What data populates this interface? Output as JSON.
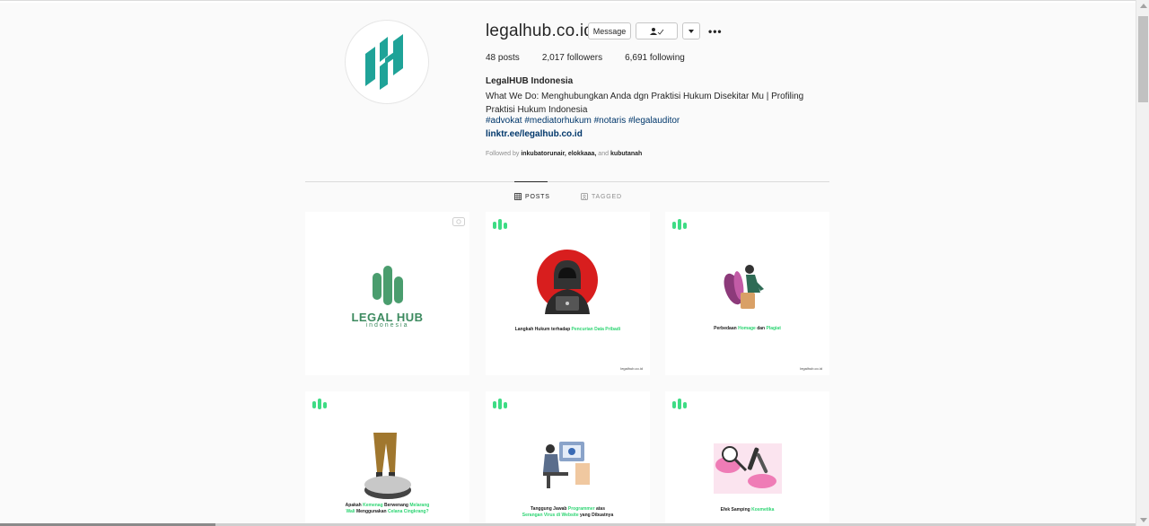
{
  "profile": {
    "username": "legalhub.co.id",
    "message_label": "Message",
    "stats": {
      "posts_count": "48",
      "posts_label": "posts",
      "followers_count": "2,017",
      "followers_label": "followers",
      "following_count": "6,691",
      "following_label": "following"
    },
    "full_name": "LegalHUB Indonesia",
    "bio": "What We Do: Menghubungkan Anda dgn Praktisi Hukum Disekitar Mu | Profiling Praktisi Hukum Indonesia",
    "hashtags": "#advokat #mediatorhukum #notaris #legalauditor",
    "link": "linktr.ee/legalhub.co.id",
    "followed_by_prefix": "Followed by",
    "followed_by_names": "inkubatorunair, elokkaaa,",
    "followed_by_and": "and",
    "followed_by_last": "kubutanah"
  },
  "tabs": [
    {
      "label": "POSTS",
      "active": true
    },
    {
      "label": "TAGGED",
      "active": false
    }
  ],
  "posts": [
    {
      "logo_text": "LEGAL HUB",
      "logo_sub": "indonesia"
    },
    {
      "caption_a": "Langkah Hukum terhadap",
      "caption_b": "Pencurian Data Pribadi",
      "footer": "legalhub.co.id"
    },
    {
      "caption_a": "Perbedaan",
      "caption_b": "Homage",
      "caption_c": "dan",
      "caption_d": "Plagiat",
      "footer": "legalhub.co.id"
    },
    {
      "caption_a": "Apakah",
      "caption_b": "Kemenag",
      "caption_c": "Berwenang",
      "caption_d": "Melarang",
      "caption_e": "Wali",
      "caption_f": "Menggunakan",
      "caption_g": "Celana Cingkrang?"
    },
    {
      "caption_a": "Tanggung Jawab",
      "caption_b": "Programmer",
      "caption_c": "atas",
      "caption_d": "Serangan Virus di Website",
      "caption_e": "yang Dibuatnya"
    },
    {
      "caption_a": "Efek Samping",
      "caption_b": "Kosmetika"
    }
  ],
  "colors": {
    "brand_teal": "#1fa398",
    "brand_green": "#3ddc84",
    "link_blue": "#00376b",
    "logo_green": "#4a9d6e"
  }
}
